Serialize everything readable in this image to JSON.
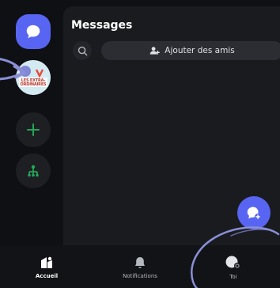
{
  "panel": {
    "title": "Messages",
    "add_friends_label": "Ajouter des amis"
  },
  "rail": {
    "server_logo_text": "LES EXTRA-ORDINAIRES"
  },
  "bottom_nav": {
    "items": [
      {
        "label": "Accueil",
        "icon": "home-icon",
        "active": true
      },
      {
        "label": "Notifications",
        "icon": "bell-icon",
        "active": false
      },
      {
        "label": "Toi",
        "icon": "avatar",
        "active": false
      }
    ]
  },
  "colors": {
    "accent": "#5865f2",
    "green": "#23a55a",
    "background": "#0f1014",
    "annotation": "#8a8fd6"
  }
}
